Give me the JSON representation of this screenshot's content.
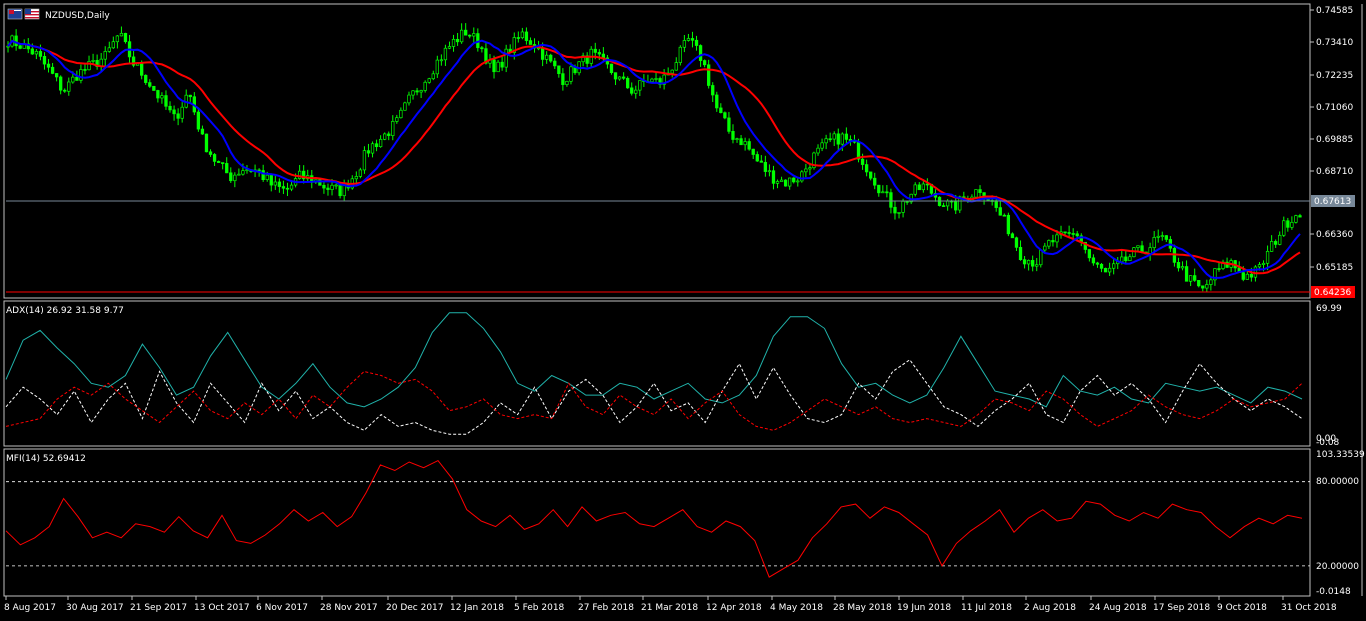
{
  "window": {
    "symbol_title": "NZDUSD,Daily"
  },
  "colors": {
    "background": "#000000",
    "frame": "#c0c0c0",
    "candle": "#00ff00",
    "ma_fast": "#0000ff",
    "ma_slow": "#ff0000",
    "price_line": "#778899",
    "ask_line": "#ff0000",
    "adx": "#20b2aa",
    "plus_di": "#ffffff",
    "minus_di": "#ff0000",
    "mfi": "#ff0000",
    "level": "#ffffff"
  },
  "chart_data": [
    {
      "type": "candlestick",
      "title": "NZDUSD,Daily",
      "price_axis_ticks": [
        "0.74585",
        "0.73410",
        "0.72235",
        "0.71060",
        "0.69885",
        "0.68710",
        "0.66360",
        "0.65185"
      ],
      "ylim": [
        0.6455,
        0.7485
      ],
      "current_price_label": "0.67613",
      "ask_price_label": "0.64236",
      "date_ticks": [
        "8 Aug 2017",
        "30 Aug 2017",
        "21 Sep 2017",
        "13 Oct 2017",
        "6 Nov 2017",
        "28 Nov 2017",
        "20 Dec 2017",
        "12 Jan 2018",
        "5 Feb 2018",
        "27 Feb 2018",
        "21 Mar 2018",
        "12 Apr 2018",
        "4 May 2018",
        "28 May 2018",
        "19 Jun 2018",
        "11 Jul 2018",
        "2 Aug 2018",
        "24 Aug 2018",
        "17 Sep 2018",
        "9 Oct 2018",
        "31 Oct 2018"
      ],
      "close_anchors": [
        0.736,
        0.734,
        0.731,
        0.725,
        0.718,
        0.724,
        0.727,
        0.73,
        0.738,
        0.728,
        0.722,
        0.715,
        0.708,
        0.718,
        0.701,
        0.693,
        0.688,
        0.691,
        0.69,
        0.685,
        0.683,
        0.688,
        0.687,
        0.684,
        0.683,
        0.689,
        0.698,
        0.702,
        0.707,
        0.716,
        0.722,
        0.729,
        0.735,
        0.739,
        0.734,
        0.724,
        0.732,
        0.738,
        0.734,
        0.728,
        0.722,
        0.727,
        0.731,
        0.727,
        0.722,
        0.718,
        0.722,
        0.721,
        0.728,
        0.736,
        0.729,
        0.712,
        0.703,
        0.7,
        0.693,
        0.688,
        0.686,
        0.688,
        0.695,
        0.7,
        0.702,
        0.698,
        0.69,
        0.682,
        0.676,
        0.682,
        0.685,
        0.68,
        0.677,
        0.681,
        0.684,
        0.678,
        0.67,
        0.66,
        0.658,
        0.665,
        0.667,
        0.668,
        0.658,
        0.654,
        0.657,
        0.661,
        0.663,
        0.667,
        0.659,
        0.652,
        0.648,
        0.655,
        0.658,
        0.653,
        0.655,
        0.664,
        0.672,
        0.676
      ],
      "series": [
        {
          "name": "",
          "color": "#0000ff",
          "kind": "moving_average_fast"
        },
        {
          "name": "",
          "color": "#ff0000",
          "kind": "moving_average_slow"
        }
      ]
    },
    {
      "type": "line",
      "title": "ADX(14) 26.92 31.58 9.77",
      "axis_ticks": [
        "69.99",
        "0.00",
        "-0.08"
      ],
      "ylim": [
        -2,
        72
      ],
      "series": [
        {
          "name": "",
          "color": "#20b2aa",
          "style": "solid",
          "values": [
            32,
            52,
            57,
            48,
            40,
            30,
            28,
            34,
            50,
            38,
            24,
            28,
            44,
            56,
            42,
            28,
            22,
            30,
            40,
            28,
            20,
            18,
            22,
            28,
            38,
            56,
            66,
            66,
            58,
            46,
            30,
            26,
            34,
            30,
            24,
            24,
            30,
            28,
            22,
            26,
            30,
            22,
            20,
            24,
            34,
            54,
            64,
            64,
            58,
            40,
            28,
            30,
            24,
            20,
            24,
            38,
            54,
            40,
            26,
            24,
            22,
            18,
            34,
            26,
            24,
            28,
            22,
            20,
            30,
            28,
            26,
            28,
            24,
            20,
            28,
            26,
            22
          ]
        },
        {
          "name": "",
          "color": "#ffffff",
          "style": "dashed",
          "values": [
            18,
            28,
            22,
            14,
            26,
            10,
            22,
            30,
            12,
            36,
            20,
            10,
            30,
            20,
            10,
            30,
            16,
            26,
            12,
            18,
            10,
            6,
            14,
            8,
            10,
            6,
            4,
            4,
            10,
            20,
            14,
            28,
            12,
            26,
            32,
            24,
            10,
            18,
            30,
            16,
            20,
            10,
            26,
            40,
            22,
            38,
            24,
            12,
            10,
            14,
            30,
            22,
            36,
            42,
            30,
            18,
            14,
            8,
            16,
            22,
            30,
            14,
            10,
            26,
            34,
            24,
            30,
            22,
            10,
            26,
            40,
            30,
            22,
            16,
            22,
            18,
            12
          ]
        },
        {
          "name": "",
          "color": "#ff0000",
          "style": "dashed",
          "values": [
            8,
            10,
            12,
            22,
            28,
            24,
            30,
            22,
            16,
            10,
            18,
            26,
            16,
            12,
            20,
            14,
            22,
            12,
            24,
            18,
            28,
            36,
            34,
            30,
            32,
            26,
            16,
            18,
            22,
            14,
            12,
            14,
            12,
            30,
            18,
            14,
            24,
            18,
            14,
            22,
            12,
            20,
            26,
            14,
            8,
            6,
            10,
            16,
            22,
            18,
            14,
            18,
            12,
            10,
            12,
            10,
            8,
            14,
            22,
            20,
            16,
            26,
            22,
            14,
            8,
            12,
            16,
            24,
            18,
            14,
            12,
            16,
            22,
            18,
            20,
            22,
            30
          ]
        }
      ]
    },
    {
      "type": "line",
      "title": "MFI(14) 52.69412",
      "axis_ticks": [
        "103.33539",
        "80.00000",
        "20.00000",
        "-0.0148"
      ],
      "ylim": [
        -1.5,
        103.3
      ],
      "levels": [
        80,
        20
      ],
      "series": [
        {
          "name": "",
          "color": "#ff0000",
          "values": [
            45,
            35,
            40,
            48,
            68,
            55,
            40,
            44,
            40,
            50,
            48,
            44,
            55,
            45,
            40,
            56,
            38,
            36,
            42,
            50,
            60,
            52,
            58,
            48,
            55,
            72,
            92,
            88,
            94,
            90,
            95,
            82,
            60,
            52,
            48,
            56,
            46,
            50,
            60,
            48,
            62,
            52,
            56,
            58,
            50,
            48,
            54,
            60,
            48,
            44,
            52,
            48,
            38,
            12,
            18,
            24,
            40,
            50,
            62,
            64,
            54,
            62,
            58,
            50,
            42,
            20,
            36,
            45,
            52,
            60,
            44,
            54,
            60,
            52,
            54,
            66,
            64,
            56,
            52,
            58,
            54,
            64,
            60,
            58,
            48,
            40,
            48,
            54,
            50,
            56,
            54
          ]
        }
      ]
    }
  ]
}
